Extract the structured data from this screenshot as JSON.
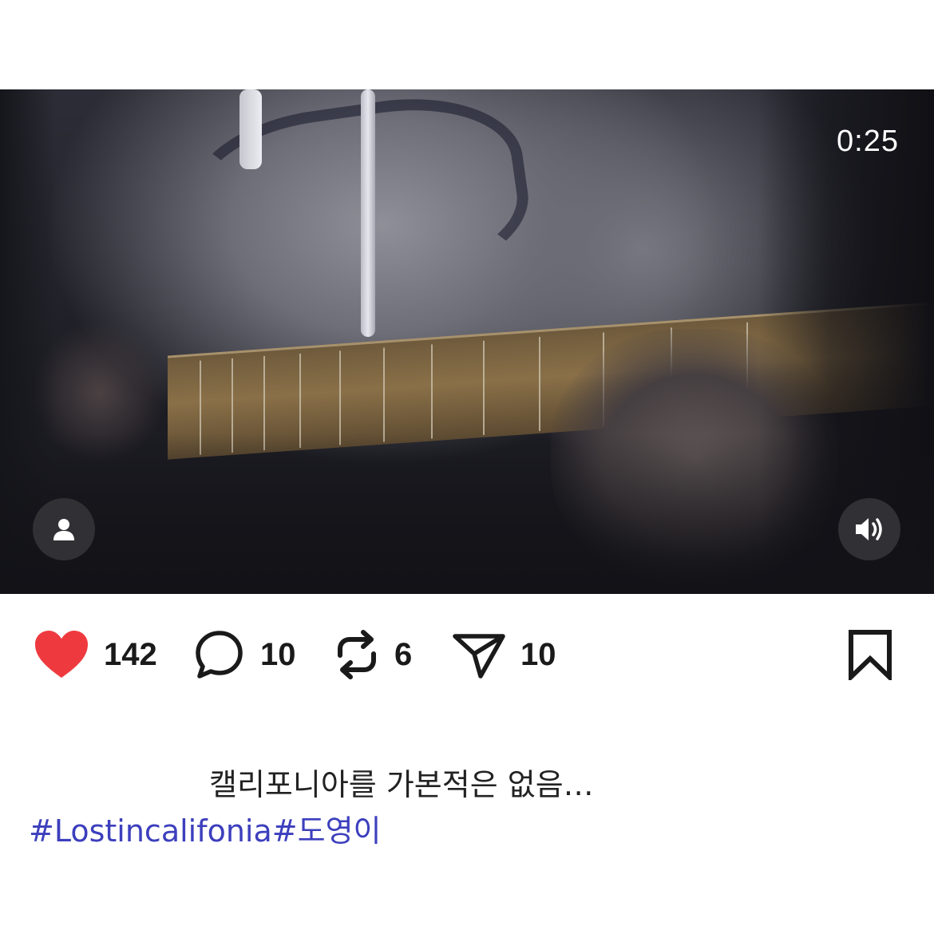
{
  "video": {
    "duration": "0:25",
    "user_tag_icon": "person-icon",
    "sound_icon": "speaker-icon"
  },
  "actions": {
    "likes": "142",
    "comments": "10",
    "reposts": "6",
    "shares": "10",
    "like_icon": "heart-icon",
    "comment_icon": "comment-bubble-icon",
    "repost_icon": "repost-icon",
    "share_icon": "paper-plane-icon",
    "save_icon": "bookmark-icon"
  },
  "post": {
    "caption": "캘리포니아를 가본적은 없음…",
    "hashtags": [
      "#Lostincalifonia",
      "#도영이"
    ]
  },
  "colors": {
    "like": "#ee3a3f",
    "hashtag": "#3c3fbd",
    "icon": "#1a1a1a"
  }
}
